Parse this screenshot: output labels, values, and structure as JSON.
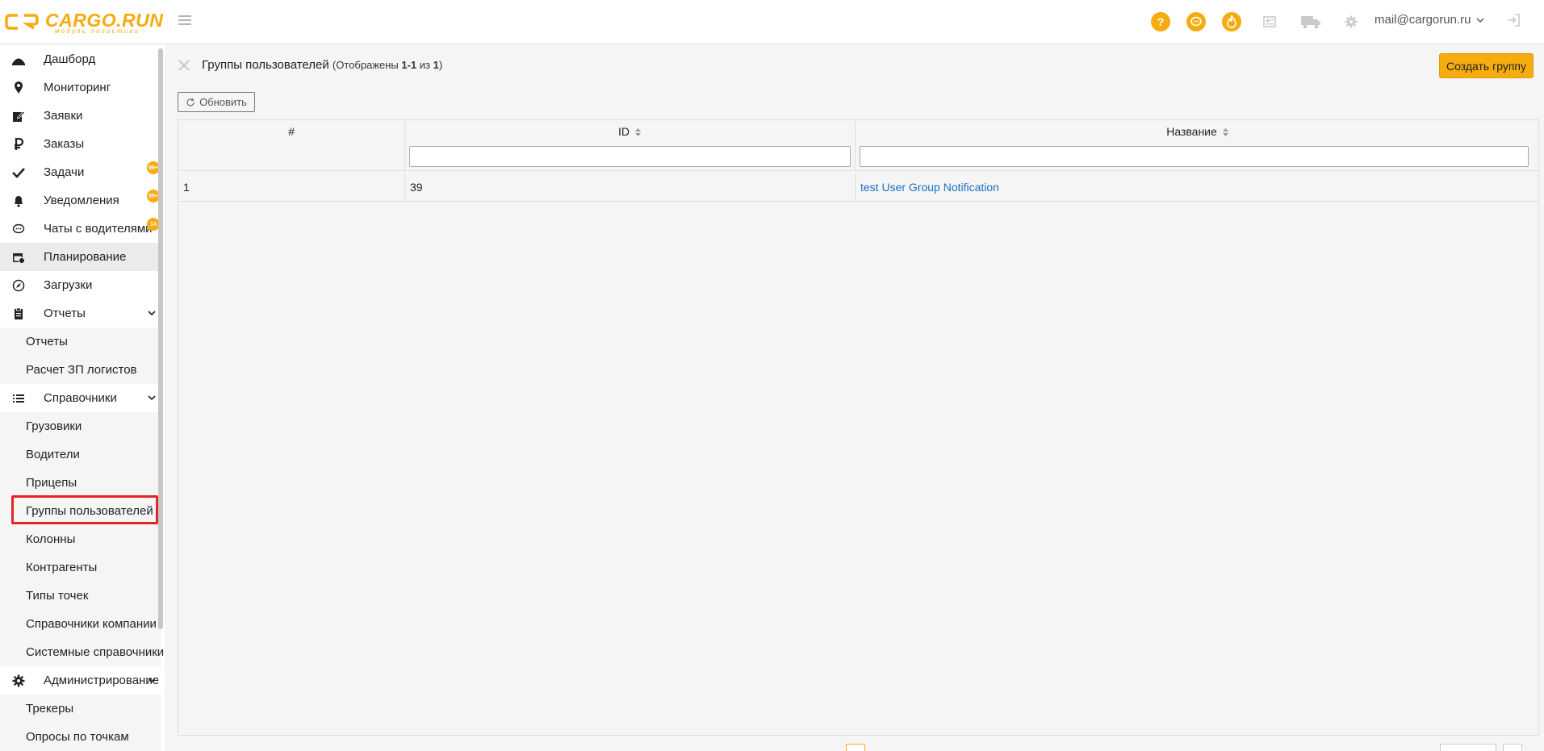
{
  "header": {
    "brand": "CARGO.RUN",
    "brand_sub": "модуль логистики",
    "user_email": "mail@cargorun.ru",
    "icons": [
      "help-icon",
      "chat-icon",
      "fire-icon",
      "newspaper-icon",
      "truck-icon",
      "gear-icon",
      "logout-icon"
    ],
    "help_glyph": "?"
  },
  "sidebar": {
    "items": [
      {
        "label": "Дашборд",
        "icon": "dashboard-icon"
      },
      {
        "label": "Мониторинг",
        "icon": "map-pin-icon"
      },
      {
        "label": "Заявки",
        "icon": "edit-icon"
      },
      {
        "label": "Заказы",
        "icon": "ruble-icon"
      },
      {
        "label": "Задачи",
        "icon": "check-icon",
        "badge": "99+"
      },
      {
        "label": "Уведомления",
        "icon": "bell-icon",
        "badge": "99+"
      },
      {
        "label": "Чаты с водителями",
        "icon": "comment-icon",
        "badge": "14"
      },
      {
        "label": "Планирование",
        "icon": "calendar-icon"
      },
      {
        "label": "Загрузки",
        "icon": "compass-icon"
      },
      {
        "label": "Отчеты",
        "icon": "clipboard-icon"
      },
      {
        "label": "Отчеты"
      },
      {
        "label": "Расчет ЗП логистов"
      },
      {
        "label": "Справочники",
        "icon": "list-icon"
      },
      {
        "label": "Грузовики"
      },
      {
        "label": "Водители"
      },
      {
        "label": "Прицепы"
      },
      {
        "label": "Группы пользователей"
      },
      {
        "label": "Колонны"
      },
      {
        "label": "Контрагенты"
      },
      {
        "label": "Типы точек"
      },
      {
        "label": "Справочники компании"
      },
      {
        "label": "Системные справочники"
      },
      {
        "label": "Администрирование",
        "icon": "gear-icon"
      },
      {
        "label": "Трекеры"
      },
      {
        "label": "Опросы по точкам"
      }
    ]
  },
  "page": {
    "title": "Группы пользователей",
    "meta_prefix": "(Отображены ",
    "meta_range": "1-1",
    "meta_of": " из ",
    "meta_total": "1",
    "meta_suffix": ")",
    "create_label": "Создать группу",
    "refresh_label": "Обновить"
  },
  "table": {
    "columns": [
      "#",
      "ID",
      "Название"
    ],
    "rows": [
      {
        "num": "1",
        "id": "39",
        "name": "test User Group Notification"
      }
    ]
  },
  "colors": {
    "accent": "#f6ac0e",
    "link": "#1a6fc2",
    "highlight": "#e42525"
  }
}
